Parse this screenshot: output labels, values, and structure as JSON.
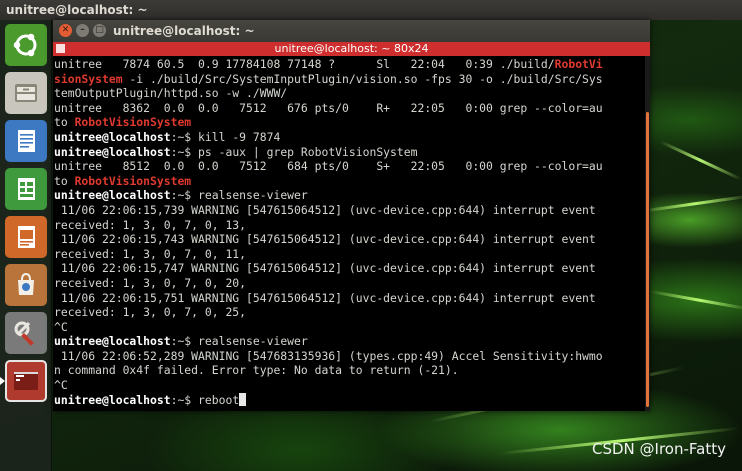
{
  "top_panel": {
    "title": "unitree@localhost: ~"
  },
  "window": {
    "title": "unitree@localhost: ~",
    "tab_label": "unitree@localhost: ~ 80x24"
  },
  "terminal": {
    "lines": [
      {
        "segments": [
          {
            "t": "unitree   7874 60.5  0.9 17784108 77148 ?      Sl   22:04   0:39 ./build/"
          },
          {
            "t": "RobotVi",
            "c": "hl"
          }
        ]
      },
      {
        "segments": [
          {
            "t": "sionSystem",
            "c": "hl"
          },
          {
            "t": " -i ./build/Src/SystemInputPlugin/vision.so -fps 30 -o ./build/Src/Sys"
          }
        ]
      },
      {
        "segments": [
          {
            "t": "temOutputPlugin/httpd.so -w ./WWW/"
          }
        ]
      },
      {
        "segments": [
          {
            "t": "unitree   8362  0.0  0.0   7512   676 pts/0    R+   22:05   0:00 grep --color=au"
          }
        ]
      },
      {
        "segments": [
          {
            "t": "to "
          },
          {
            "t": "RobotVisionSystem",
            "c": "hl"
          }
        ]
      },
      {
        "segments": [
          {
            "t": "unitree@localhost",
            "c": "prompt"
          },
          {
            "t": ":~$ kill -9 7874"
          }
        ]
      },
      {
        "segments": [
          {
            "t": "unitree@localhost",
            "c": "prompt"
          },
          {
            "t": ":~$ ps -aux | grep RobotVisionSystem"
          }
        ]
      },
      {
        "segments": [
          {
            "t": "unitree   8512  0.0  0.0   7512   684 pts/0    S+   22:05   0:00 grep --color=au"
          }
        ]
      },
      {
        "segments": [
          {
            "t": "to "
          },
          {
            "t": "RobotVisionSystem",
            "c": "hl"
          }
        ]
      },
      {
        "segments": [
          {
            "t": "unitree@localhost",
            "c": "prompt"
          },
          {
            "t": ":~$ realsense-viewer"
          }
        ]
      },
      {
        "segments": [
          {
            "t": " 11/06 22:06:15,739 WARNING [547615064512] (uvc-device.cpp:644) interrupt event"
          }
        ]
      },
      {
        "segments": [
          {
            "t": "received: 1, 3, 0, 7, 0, 13,"
          }
        ]
      },
      {
        "segments": [
          {
            "t": " 11/06 22:06:15,743 WARNING [547615064512] (uvc-device.cpp:644) interrupt event"
          }
        ]
      },
      {
        "segments": [
          {
            "t": "received: 1, 3, 0, 7, 0, 11,"
          }
        ]
      },
      {
        "segments": [
          {
            "t": " 11/06 22:06:15,747 WARNING [547615064512] (uvc-device.cpp:644) interrupt event"
          }
        ]
      },
      {
        "segments": [
          {
            "t": "received: 1, 3, 0, 7, 0, 20,"
          }
        ]
      },
      {
        "segments": [
          {
            "t": " 11/06 22:06:15,751 WARNING [547615064512] (uvc-device.cpp:644) interrupt event"
          }
        ]
      },
      {
        "segments": [
          {
            "t": "received: 1, 3, 0, 7, 0, 25,"
          }
        ]
      },
      {
        "segments": [
          {
            "t": "^C"
          }
        ]
      },
      {
        "segments": [
          {
            "t": "unitree@localhost",
            "c": "prompt"
          },
          {
            "t": ":~$ realsense-viewer"
          }
        ]
      },
      {
        "segments": [
          {
            "t": " 11/06 22:06:52,289 WARNING [547683135936] (types.cpp:49) Accel Sensitivity:hwmo"
          }
        ]
      },
      {
        "segments": [
          {
            "t": "n command 0x4f failed. Error type: No data to return (-21)."
          }
        ]
      },
      {
        "segments": [
          {
            "t": "^C"
          }
        ]
      },
      {
        "segments": [
          {
            "t": "unitree@localhost",
            "c": "prompt"
          },
          {
            "t": ":~$ reboot"
          }
        ],
        "cursor": true
      }
    ]
  },
  "launcher": {
    "items": [
      {
        "icon": "ubuntu-dash-icon"
      },
      {
        "icon": "file-manager-icon"
      },
      {
        "icon": "writer-document-icon"
      },
      {
        "icon": "calc-spreadsheet-icon"
      },
      {
        "icon": "impress-presentation-icon"
      },
      {
        "icon": "software-center-icon"
      },
      {
        "icon": "system-settings-icon"
      },
      {
        "icon": "terminal-icon",
        "active": true
      }
    ]
  },
  "watermark": "CSDN @Iron-Fatty",
  "colors": {
    "accent_red": "#cf2e2e",
    "highlight_match": "#e03a2f",
    "scroll_thumb": "#e2733a",
    "terminal_bg": "#000000",
    "terminal_fg": "#d3d7cf"
  }
}
